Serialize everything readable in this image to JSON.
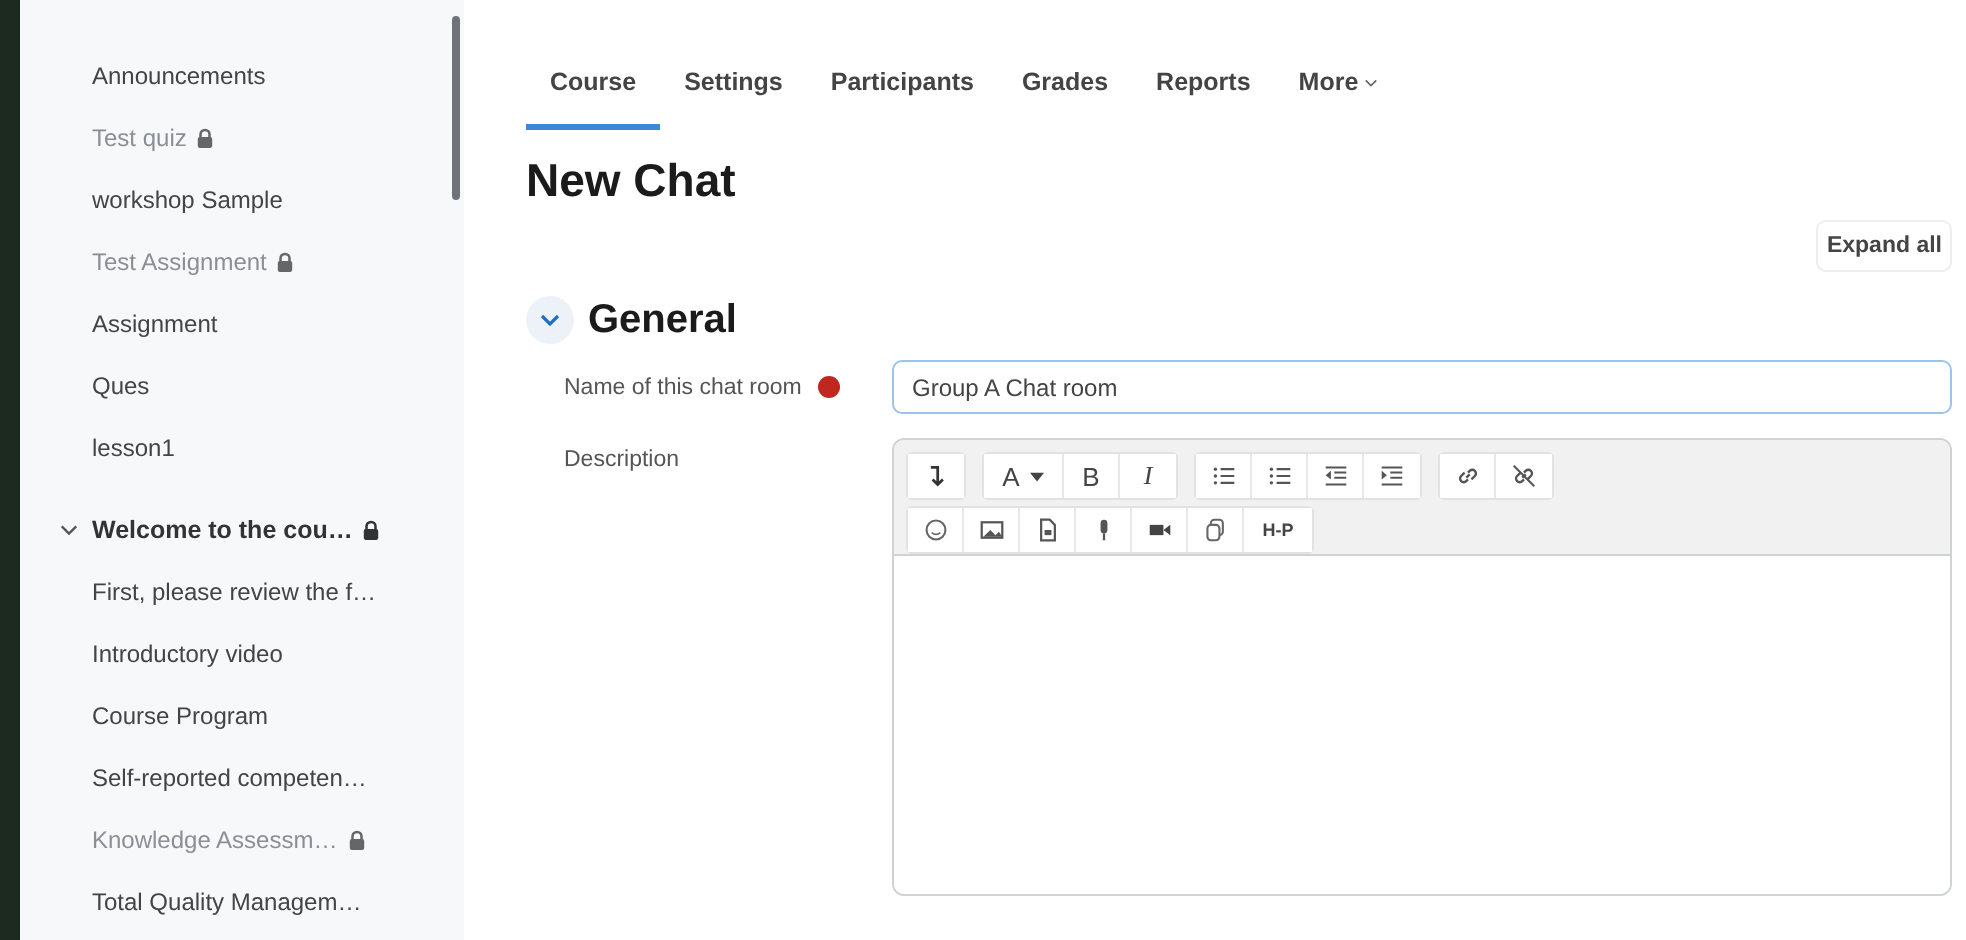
{
  "sidebar": {
    "items": [
      {
        "label": "Announcements",
        "locked": false
      },
      {
        "label": "Test quiz",
        "locked": true
      },
      {
        "label": "workshop Sample",
        "locked": false
      },
      {
        "label": "Test Assignment",
        "locked": true
      },
      {
        "label": "Assignment",
        "locked": false
      },
      {
        "label": "Ques",
        "locked": false
      },
      {
        "label": "lesson1",
        "locked": false
      }
    ],
    "section": {
      "title": "Welcome to the cou…",
      "locked": true,
      "expanded": true,
      "children": [
        {
          "label": "First, please review the f…",
          "locked": false
        },
        {
          "label": "Introductory video",
          "locked": false
        },
        {
          "label": "Course Program",
          "locked": false
        },
        {
          "label": "Self-reported competen…",
          "locked": false
        },
        {
          "label": "Knowledge Assessm…",
          "locked": true
        },
        {
          "label": "Total Quality Managem…",
          "locked": false
        }
      ]
    }
  },
  "tabs": [
    {
      "label": "Course",
      "selected": true
    },
    {
      "label": "Settings",
      "selected": false
    },
    {
      "label": "Participants",
      "selected": false
    },
    {
      "label": "Grades",
      "selected": false
    },
    {
      "label": "Reports",
      "selected": false
    },
    {
      "label": "More",
      "selected": false
    }
  ],
  "page_title": "New Chat",
  "expand_all": "Expand all",
  "section": {
    "title": "General",
    "expanded": true
  },
  "fields": [
    {
      "label": "Name of this chat room",
      "required": true,
      "value": "Group A Chat room"
    }
  ],
  "description": {
    "label": "Description",
    "toolbar": [
      [
        [
          {
            "kind": "collapse"
          }
        ],
        [
          {
            "kind": "font",
            "label": "A"
          },
          {
            "kind": "bold",
            "label": "B"
          },
          {
            "kind": "italic",
            "label": "I"
          }
        ],
        [
          {
            "kind": "ul"
          },
          {
            "kind": "ol"
          },
          {
            "kind": "outdent"
          },
          {
            "kind": "indent"
          }
        ],
        [
          {
            "kind": "link"
          },
          {
            "kind": "unlink"
          }
        ]
      ],
      [
        [
          {
            "kind": "emoji"
          },
          {
            "kind": "image"
          },
          {
            "kind": "file"
          },
          {
            "kind": "mic"
          },
          {
            "kind": "video"
          },
          {
            "kind": "copy"
          },
          {
            "kind": "h5p",
            "label": "H-P"
          }
        ]
      ]
    ]
  }
}
